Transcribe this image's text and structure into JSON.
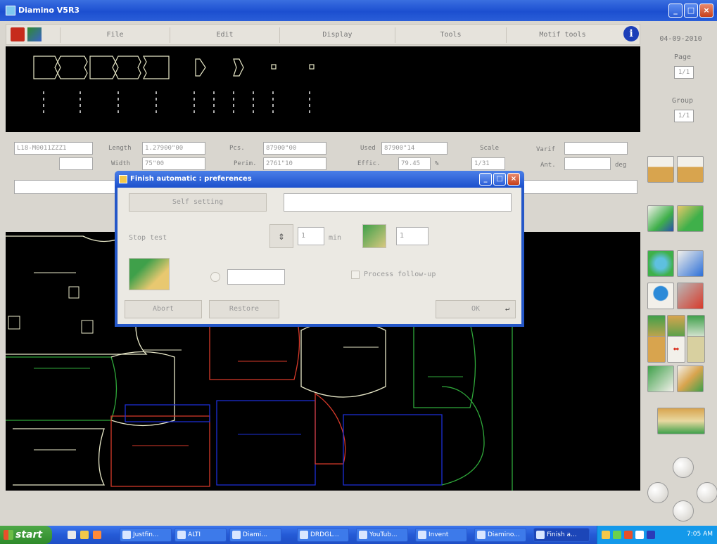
{
  "window": {
    "title": "Diamino V5R3"
  },
  "menu": {
    "items": [
      "File",
      "Edit",
      "Display",
      "Tools",
      "Motif tools"
    ]
  },
  "right_panel": {
    "date": "04-09-2010",
    "page_label": "Page",
    "page_value": "1/1",
    "group_label": "Group",
    "group_value": "1/1"
  },
  "info": {
    "model_name": "L18-M0011ZZZ1",
    "length_label": "Length",
    "length_value": "1.27900\"00",
    "width_label": "Width",
    "width_value": "75\"00",
    "pcs_label": "Pcs.",
    "pcs_value": "87900\"00",
    "perim_label": "Perim.",
    "perim_value": "2761\"10",
    "used_label": "Used",
    "used_value": "87900\"14",
    "effic_label": "Effic.",
    "effic_value": "79.45",
    "effic_unit": "%",
    "scale_label": "Scale",
    "scale_value": "1/31",
    "varif_label": "Varif",
    "varif_value": "",
    "ant_label": "Ant.",
    "ant_value": "",
    "ant_unit": "deg"
  },
  "dialog": {
    "title": "Finish automatic : preferences",
    "self_setting_label": "Self setting",
    "self_setting_value": "",
    "stop_test_label": "Stop test",
    "min_value": "1",
    "min_unit": "min",
    "count_value": "1",
    "extra_value": "",
    "process_followup_label": "Process follow-up",
    "abort_label": "Abort",
    "restore_label": "Restore",
    "ok_label": "OK"
  },
  "taskbar": {
    "start_label": "start",
    "tasks": [
      "Justfin...",
      "ALTI",
      "Diami...",
      "DRDGL...",
      "YouTub...",
      "Invent",
      "Diamino...",
      "Finish a..."
    ],
    "clock": "7:05 AM"
  }
}
